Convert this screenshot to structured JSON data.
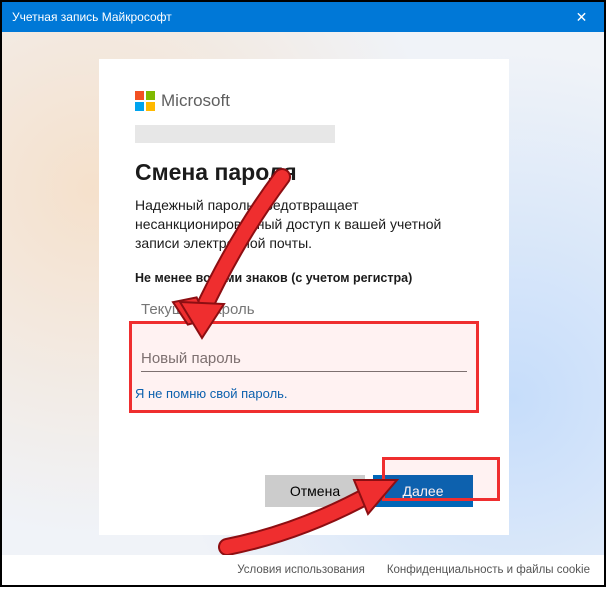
{
  "window": {
    "title": "Учетная запись Майкрософт",
    "close_icon": "✕"
  },
  "brand": {
    "name": "Microsoft"
  },
  "heading": "Смена пароля",
  "description": "Надежный пароль предотвращает несанкционированный доступ к вашей учетной записи электронной почты.",
  "hint": "Не менее восьми знаков (с учетом регистра)",
  "fields": {
    "current_placeholder": "Текущий пароль",
    "new_placeholder": "Новый пароль"
  },
  "forgot_link": "Я не помню свой пароль.",
  "buttons": {
    "cancel": "Отмена",
    "next": "Далее"
  },
  "footer": {
    "terms": "Условия использования",
    "privacy": "Конфиденциальность и файлы cookie"
  }
}
